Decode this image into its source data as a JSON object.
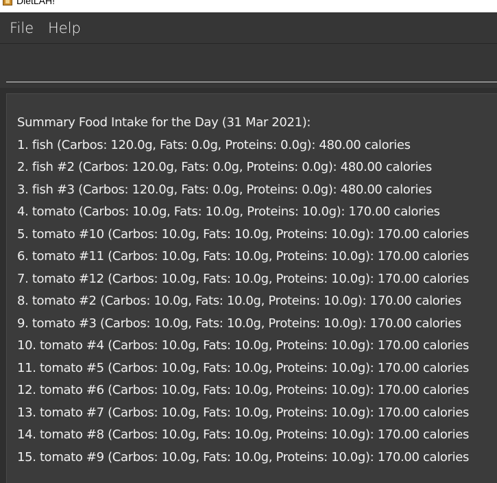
{
  "window": {
    "title": "DietLAH!",
    "icon": "app-icon"
  },
  "menubar": {
    "items": [
      "File",
      "Help"
    ]
  },
  "command_box": {
    "value": "",
    "placeholder": ""
  },
  "result": {
    "header": "Summary Food Intake for the Day (31 Mar 2021):",
    "lines": [
      "1. fish (Carbos: 120.0g, Fats: 0.0g, Proteins: 0.0g): 480.00 calories",
      "2. fish #2 (Carbos: 120.0g, Fats: 0.0g, Proteins: 0.0g): 480.00 calories",
      "3. fish #3 (Carbos: 120.0g, Fats: 0.0g, Proteins: 0.0g): 480.00 calories",
      "4. tomato (Carbos: 10.0g, Fats: 10.0g, Proteins: 10.0g): 170.00 calories",
      "5. tomato #10 (Carbos: 10.0g, Fats: 10.0g, Proteins: 10.0g): 170.00 calories",
      "6. tomato #11 (Carbos: 10.0g, Fats: 10.0g, Proteins: 10.0g): 170.00 calories",
      "7. tomato #12 (Carbos: 10.0g, Fats: 10.0g, Proteins: 10.0g): 170.00 calories",
      "8. tomato #2 (Carbos: 10.0g, Fats: 10.0g, Proteins: 10.0g): 170.00 calories",
      "9. tomato #3 (Carbos: 10.0g, Fats: 10.0g, Proteins: 10.0g): 170.00 calories",
      "10. tomato #4 (Carbos: 10.0g, Fats: 10.0g, Proteins: 10.0g): 170.00 calories",
      "11. tomato #5 (Carbos: 10.0g, Fats: 10.0g, Proteins: 10.0g): 170.00 calories",
      "12. tomato #6 (Carbos: 10.0g, Fats: 10.0g, Proteins: 10.0g): 170.00 calories",
      "13. tomato #7 (Carbos: 10.0g, Fats: 10.0g, Proteins: 10.0g): 170.00 calories",
      "14. tomato #8 (Carbos: 10.0g, Fats: 10.0g, Proteins: 10.0g): 170.00 calories",
      "15. tomato #9 (Carbos: 10.0g, Fats: 10.0g, Proteins: 10.0g): 170.00 calories"
    ]
  },
  "colors": {
    "background": "#2f2f2f",
    "menubar": "#363636",
    "panel": "#3b3b3b",
    "text": "#f0f0f0"
  }
}
